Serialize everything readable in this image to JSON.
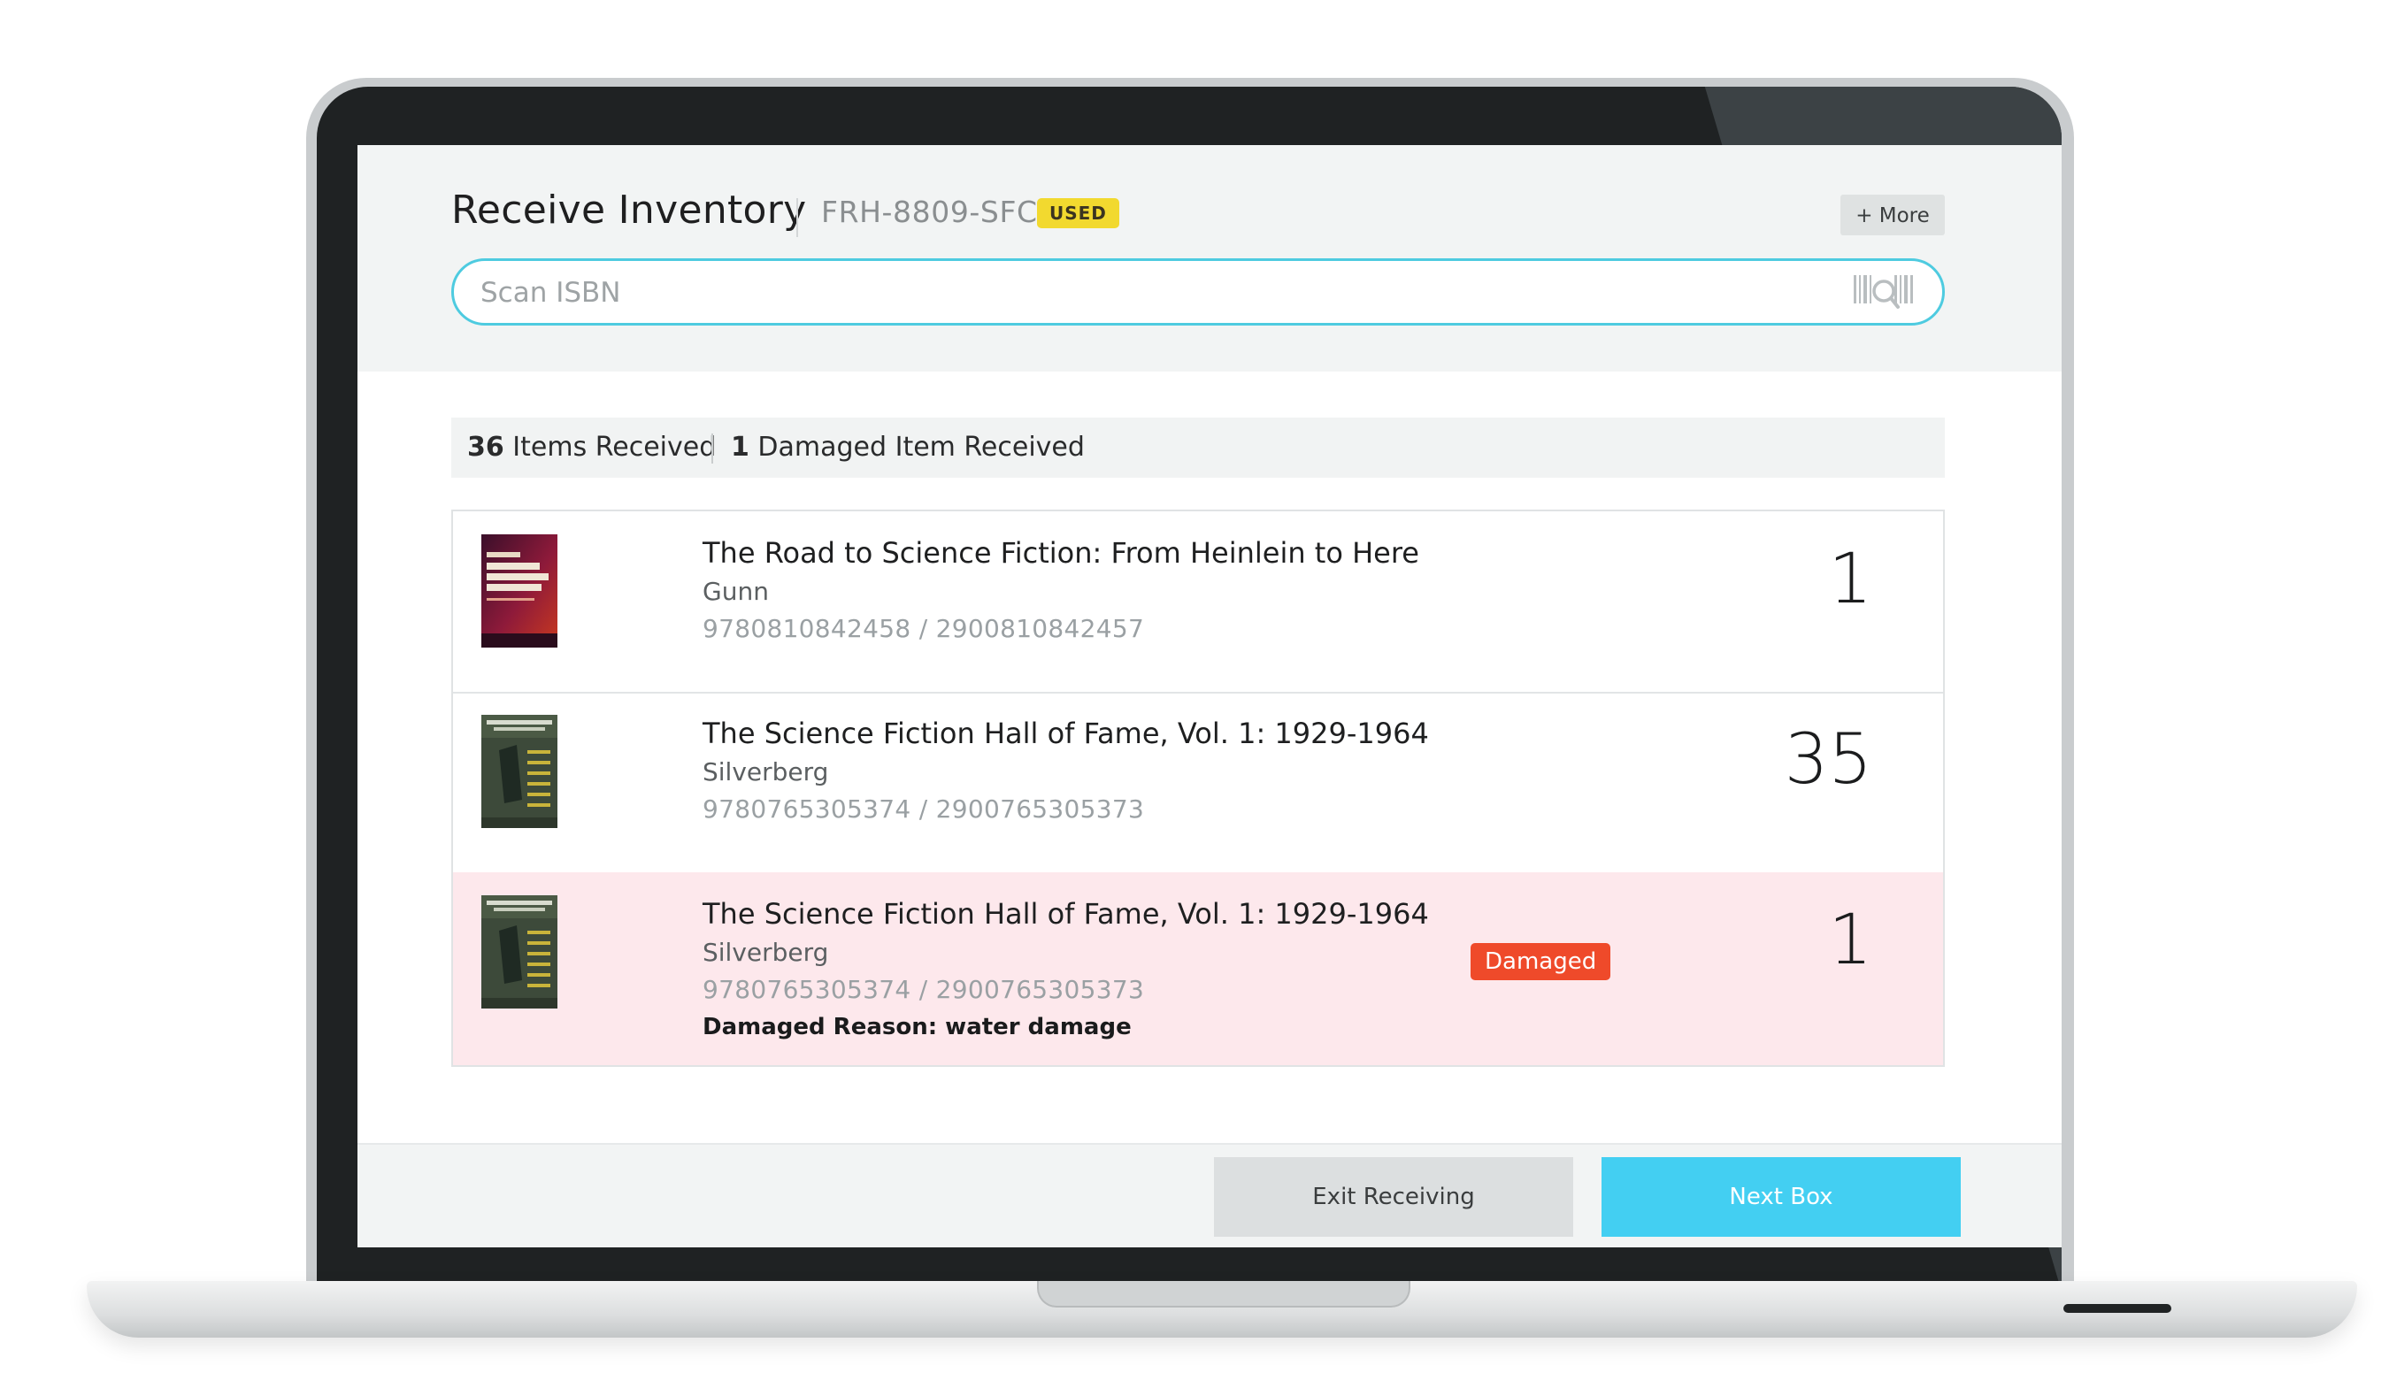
{
  "header": {
    "title": "Receive Inventory",
    "ref_code": "FRH-8809-SFC",
    "condition_badge": "USED",
    "more_label": "+ More"
  },
  "scan": {
    "placeholder": "Scan ISBN",
    "value": ""
  },
  "summary": {
    "items_count": "36",
    "items_label": "Items Received",
    "damaged_count": "1",
    "damaged_label": "Damaged Item Received"
  },
  "items": [
    {
      "title": "The Road to Science Fiction: From Heinlein to Here",
      "author": "Gunn",
      "isbn": "9780810842458 / 2900810842457",
      "quantity": "1",
      "cover_icon": "book-cover-road-to-science-fiction"
    },
    {
      "title": "The Science Fiction Hall of Fame, Vol. 1: 1929-1964",
      "author": "Silverberg",
      "isbn": "9780765305374 / 2900765305373",
      "quantity": "35",
      "cover_icon": "book-cover-science-fiction-hall-of-fame"
    },
    {
      "title": "The Science Fiction Hall of Fame, Vol. 1: 1929-1964",
      "author": "Silverberg",
      "isbn": "9780765305374 / 2900765305373",
      "quantity": "1",
      "status_badge": "Damaged",
      "damage_reason": "Damaged Reason: water damage",
      "cover_icon": "book-cover-science-fiction-hall-of-fame"
    }
  ],
  "footer": {
    "exit_label": "Exit Receiving",
    "next_label": "Next Box"
  },
  "colors": {
    "accent": "#43cff2",
    "scan_border": "#4ecbe0",
    "used_badge": "#f2d92f",
    "damaged_badge": "#ef4a2a",
    "damaged_row": "#fde8ec"
  }
}
